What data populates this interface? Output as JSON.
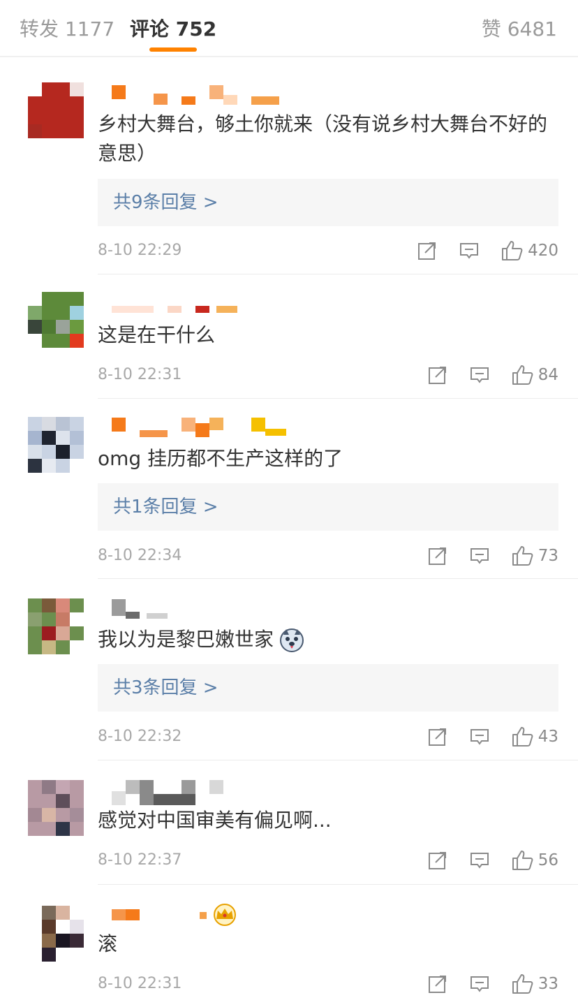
{
  "tabs": {
    "repost": "转发 1177",
    "comments": "评论 752",
    "likes": "赞 6481",
    "accent_color": "#ff8200"
  },
  "comments": [
    {
      "text": "乡村大舞台，够土你就来（没有说乡村大舞台不好的意思）",
      "replies": "共9条回复 >",
      "time": "8-10 22:29",
      "likes": "420"
    },
    {
      "text": "这是在干什么",
      "time": "8-10 22:31",
      "likes": "84"
    },
    {
      "text": "omg 挂历都不生产这样的了",
      "replies": "共1条回复 >",
      "time": "8-10 22:34",
      "likes": "73"
    },
    {
      "text": "我以为是黎巴嫩世家",
      "replies": "共3条回复 >",
      "time": "8-10 22:32",
      "likes": "43"
    },
    {
      "text": "感觉对中国审美有偏见啊...",
      "time": "8-10 22:37",
      "likes": "56"
    },
    {
      "text": "滚",
      "time": "8-10 22:31",
      "likes": "33"
    }
  ],
  "icons": {
    "repost": "repost-icon",
    "comment": "comment-icon",
    "like": "thumbs-up-icon",
    "emoji": "husky-emoji-icon",
    "badge": "crown-badge-icon"
  }
}
